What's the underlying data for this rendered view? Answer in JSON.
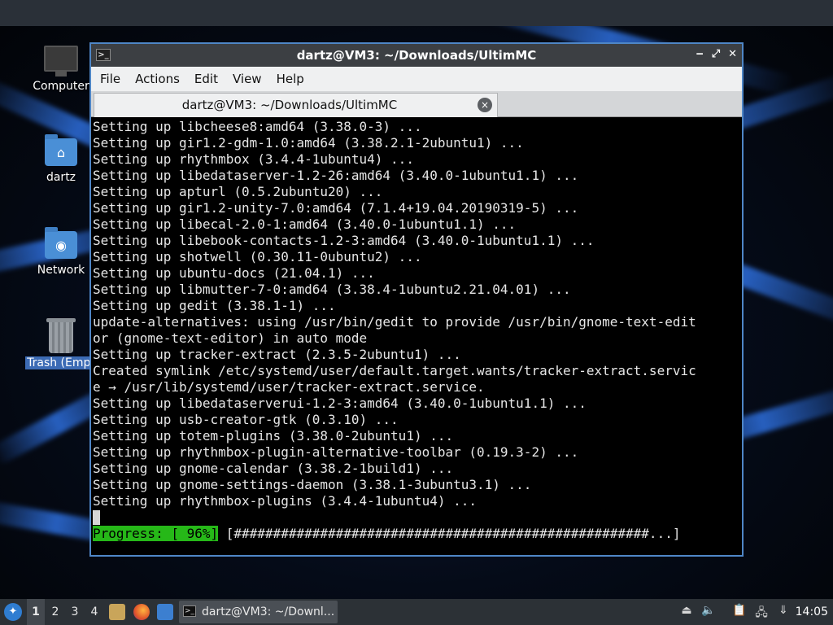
{
  "desktop": {
    "icons": [
      {
        "label": "Computer",
        "icon": "computer-icon"
      },
      {
        "label": "dartz",
        "icon": "home-folder-icon"
      },
      {
        "label": "Network",
        "icon": "network-folder-icon"
      },
      {
        "label": "Trash (Empt",
        "icon": "trash-icon"
      }
    ]
  },
  "window": {
    "title": "dartz@VM3: ~/Downloads/UltimMC",
    "app_icon": "terminal-icon",
    "controls": {
      "minimize": "‒",
      "maximize": "⤢",
      "close": "✕"
    }
  },
  "menu": [
    "File",
    "Actions",
    "Edit",
    "View",
    "Help"
  ],
  "tab": {
    "label": "dartz@VM3: ~/Downloads/UltimMC",
    "close": "×"
  },
  "console": {
    "lines": [
      "Setting up libcheese8:amd64 (3.38.0-3) ...",
      "Setting up gir1.2-gdm-1.0:amd64 (3.38.2.1-2ubuntu1) ...",
      "Setting up rhythmbox (3.4.4-1ubuntu4) ...",
      "Setting up libedataserver-1.2-26:amd64 (3.40.0-1ubuntu1.1) ...",
      "Setting up apturl (0.5.2ubuntu20) ...",
      "Setting up gir1.2-unity-7.0:amd64 (7.1.4+19.04.20190319-5) ...",
      "Setting up libecal-2.0-1:amd64 (3.40.0-1ubuntu1.1) ...",
      "Setting up libebook-contacts-1.2-3:amd64 (3.40.0-1ubuntu1.1) ...",
      "Setting up shotwell (0.30.11-0ubuntu2) ...",
      "Setting up ubuntu-docs (21.04.1) ...",
      "Setting up libmutter-7-0:amd64 (3.38.4-1ubuntu2.21.04.01) ...",
      "Setting up gedit (3.38.1-1) ...",
      "update-alternatives: using /usr/bin/gedit to provide /usr/bin/gnome-text-edit",
      "or (gnome-text-editor) in auto mode",
      "Setting up tracker-extract (2.3.5-2ubuntu1) ...",
      "Created symlink /etc/systemd/user/default.target.wants/tracker-extract.servic",
      "e → /usr/lib/systemd/user/tracker-extract.service.",
      "Setting up libedataserverui-1.2-3:amd64 (3.40.0-1ubuntu1.1) ...",
      "Setting up usb-creator-gtk (0.3.10) ...",
      "Setting up totem-plugins (3.38.0-2ubuntu1) ...",
      "Setting up rhythmbox-plugin-alternative-toolbar (0.19.3-2) ...",
      "Setting up gnome-calendar (3.38.2-1build1) ...",
      "Setting up gnome-settings-daemon (3.38.1-3ubuntu3.1) ...",
      "Setting up rhythmbox-plugins (3.4.4-1ubuntu4) ..."
    ],
    "progress": {
      "label": "Progress: [ 96%]",
      "bar": " [#####################################################...]",
      "percent": 96,
      "label_color": "#26b818"
    }
  },
  "taskbar": {
    "start_icon": "lubuntu-start-icon",
    "workspaces": [
      "1",
      "2",
      "3",
      "4"
    ],
    "active_workspace": "1",
    "quick_launch": [
      "file-manager-icon",
      "firefox-icon",
      "show-desktop-icon"
    ],
    "task": {
      "label": "dartz@VM3: ~/Downl...",
      "icon": "terminal-icon"
    },
    "tray": [
      "eject-icon",
      "volume-icon",
      "clipboard-icon",
      "network-icon",
      "update-notifier-icon"
    ],
    "clock": "14:05"
  },
  "colors": {
    "window_border": "#4f86c6",
    "progress_green": "#26b818",
    "selection_blue": "#3c6bb5"
  }
}
